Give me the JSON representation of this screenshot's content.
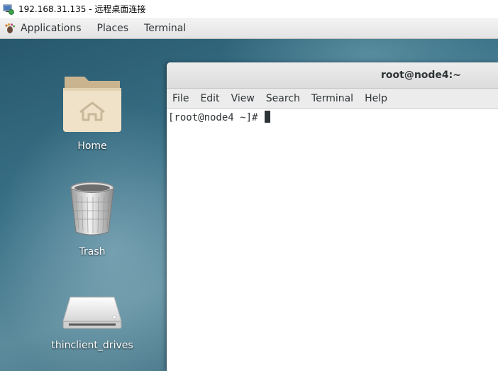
{
  "window": {
    "title": "192.168.31.135 - 远程桌面连接",
    "icon": "remote-desktop-icon"
  },
  "top_panel": {
    "items": [
      {
        "label": "Applications",
        "icon": "gnome-foot-icon"
      },
      {
        "label": "Places"
      },
      {
        "label": "Terminal"
      }
    ]
  },
  "desktop": {
    "icons": [
      {
        "label": "Home",
        "icon": "home-folder-icon"
      },
      {
        "label": "Trash",
        "icon": "trash-icon"
      },
      {
        "label": "thinclient_drives",
        "icon": "drive-icon"
      }
    ]
  },
  "terminal": {
    "title": "root@node4:~",
    "menu": [
      "File",
      "Edit",
      "View",
      "Search",
      "Terminal",
      "Help"
    ],
    "prompt": "[root@node4 ~]# "
  }
}
